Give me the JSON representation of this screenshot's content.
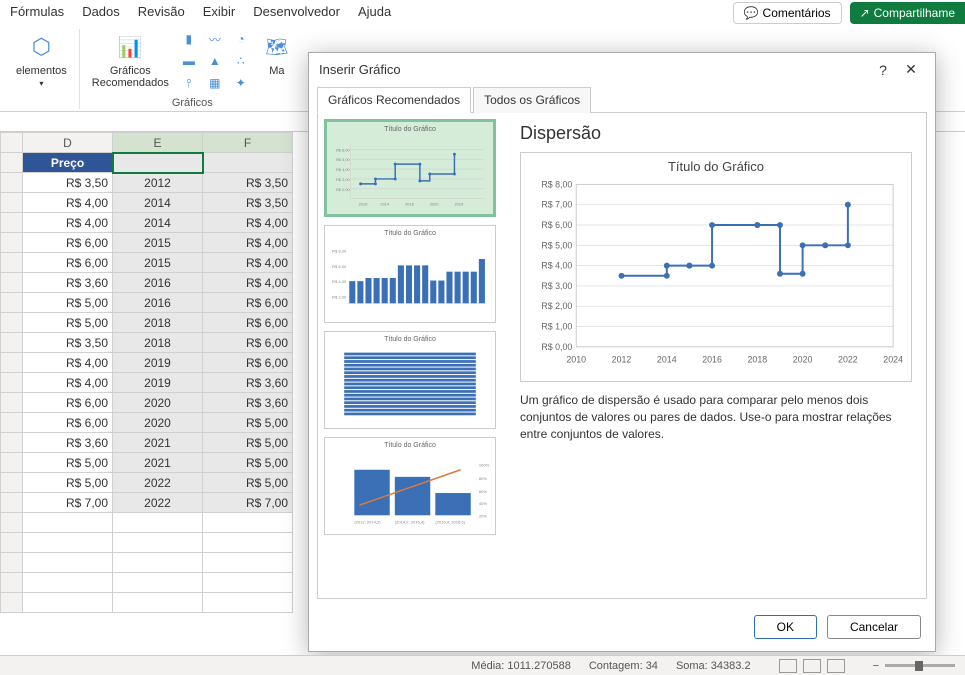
{
  "menu": {
    "items": [
      "Fórmulas",
      "Dados",
      "Revisão",
      "Exibir",
      "Desenvolvedor",
      "Ajuda"
    ]
  },
  "topright": {
    "comentarios": "Comentários",
    "compartilhar": "Compartilhame"
  },
  "ribbon": {
    "elementos": "elementos",
    "graficos_rec": "Gráficos\nRecomendados",
    "graficos_caption": "Gráficos",
    "ma": "Ma"
  },
  "sheet": {
    "cols": [
      "D",
      "E",
      "F"
    ],
    "header_d": "Preço",
    "rows": [
      {
        "d": "R$ 3,50",
        "e": "2012",
        "f": "R$ 3,50"
      },
      {
        "d": "R$ 4,00",
        "e": "2014",
        "f": "R$ 3,50"
      },
      {
        "d": "R$ 4,00",
        "e": "2014",
        "f": "R$ 4,00"
      },
      {
        "d": "R$ 6,00",
        "e": "2015",
        "f": "R$ 4,00"
      },
      {
        "d": "R$ 6,00",
        "e": "2015",
        "f": "R$ 4,00"
      },
      {
        "d": "R$ 3,60",
        "e": "2016",
        "f": "R$ 4,00"
      },
      {
        "d": "R$ 5,00",
        "e": "2016",
        "f": "R$ 6,00"
      },
      {
        "d": "R$ 5,00",
        "e": "2018",
        "f": "R$ 6,00"
      },
      {
        "d": "R$ 3,50",
        "e": "2018",
        "f": "R$ 6,00"
      },
      {
        "d": "R$ 4,00",
        "e": "2019",
        "f": "R$ 6,00"
      },
      {
        "d": "R$ 4,00",
        "e": "2019",
        "f": "R$ 3,60"
      },
      {
        "d": "R$ 6,00",
        "e": "2020",
        "f": "R$ 3,60"
      },
      {
        "d": "R$ 6,00",
        "e": "2020",
        "f": "R$ 5,00"
      },
      {
        "d": "R$ 3,60",
        "e": "2021",
        "f": "R$ 5,00"
      },
      {
        "d": "R$ 5,00",
        "e": "2021",
        "f": "R$ 5,00"
      },
      {
        "d": "R$ 5,00",
        "e": "2022",
        "f": "R$ 5,00"
      },
      {
        "d": "R$ 7,00",
        "e": "2022",
        "f": "R$ 7,00"
      }
    ]
  },
  "dialog": {
    "title": "Inserir Gráfico",
    "tab1": "Gráficos Recomendados",
    "tab2": "Todos os Gráficos",
    "thumb_title": "Título do Gráfico",
    "right_heading": "Dispersão",
    "preview_title": "Título do Gráfico",
    "desc": "Um gráfico de dispersão é usado para comparar pelo menos dois conjuntos de valores ou pares de dados. Use-o para mostrar relações entre conjuntos de valores.",
    "ok": "OK",
    "cancel": "Cancelar"
  },
  "status": {
    "media_lbl": "Média:",
    "media_val": "1011.270588",
    "contagem_lbl": "Contagem:",
    "contagem_val": "34",
    "soma_lbl": "Soma:",
    "soma_val": "34383.2"
  },
  "chart_data": {
    "type": "scatter",
    "title": "Título do Gráfico",
    "xlabel": "",
    "ylabel": "",
    "xlim": [
      2010,
      2024
    ],
    "ylim": [
      0,
      8
    ],
    "yticks": [
      "R$ 0,00",
      "R$ 1,00",
      "R$ 2,00",
      "R$ 3,00",
      "R$ 4,00",
      "R$ 5,00",
      "R$ 6,00",
      "R$ 7,00",
      "R$ 8,00"
    ],
    "xticks": [
      2010,
      2012,
      2014,
      2016,
      2018,
      2020,
      2022,
      2024
    ],
    "series": [
      {
        "name": "Preço",
        "points": [
          {
            "x": 2012,
            "y": 3.5
          },
          {
            "x": 2014,
            "y": 3.5
          },
          {
            "x": 2014,
            "y": 4.0
          },
          {
            "x": 2015,
            "y": 4.0
          },
          {
            "x": 2015,
            "y": 4.0
          },
          {
            "x": 2016,
            "y": 4.0
          },
          {
            "x": 2016,
            "y": 6.0
          },
          {
            "x": 2018,
            "y": 6.0
          },
          {
            "x": 2018,
            "y": 6.0
          },
          {
            "x": 2019,
            "y": 6.0
          },
          {
            "x": 2019,
            "y": 3.6
          },
          {
            "x": 2020,
            "y": 3.6
          },
          {
            "x": 2020,
            "y": 5.0
          },
          {
            "x": 2021,
            "y": 5.0
          },
          {
            "x": 2021,
            "y": 5.0
          },
          {
            "x": 2022,
            "y": 5.0
          },
          {
            "x": 2022,
            "y": 7.0
          }
        ]
      }
    ]
  }
}
